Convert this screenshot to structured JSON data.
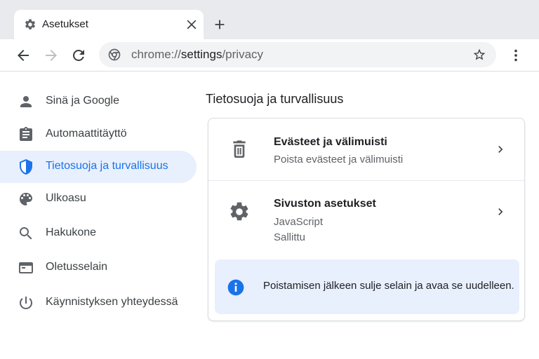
{
  "tab": {
    "title": "Asetukset",
    "icon": "gear-icon"
  },
  "omnibox": {
    "scheme": "chrome://",
    "host": "settings",
    "path": "/privacy"
  },
  "sidebar": {
    "items": [
      {
        "label": "Sinä ja Google",
        "icon": "person-icon",
        "active": false
      },
      {
        "label": "Automaattitäyttö",
        "icon": "clipboard-icon",
        "active": false
      },
      {
        "label": "Tietosuoja ja turvallisuus",
        "icon": "shield-icon",
        "active": true
      },
      {
        "label": "Ulkoasu",
        "icon": "palette-icon",
        "active": false
      },
      {
        "label": "Hakukone",
        "icon": "search-icon",
        "active": false
      },
      {
        "label": "Oletusselain",
        "icon": "browser-window-icon",
        "active": false
      },
      {
        "label": "Käynnistyksen yhteydessä",
        "icon": "power-icon",
        "active": false
      }
    ]
  },
  "main": {
    "title": "Tietosuoja ja turvallisuus",
    "rows": [
      {
        "title": "Evästeet ja välimuisti",
        "subtitle": "Poista evästeet ja välimuisti",
        "icon": "trash-icon"
      },
      {
        "title": "Sivuston asetukset",
        "subtitle": "JavaScript",
        "status": "Sallittu",
        "icon": "gear-icon"
      }
    ],
    "info": {
      "text": "Poistamisen jälkeen sulje selain ja avaa se uudelleen.",
      "icon": "info-icon"
    }
  },
  "colors": {
    "accent": "#1a73e8",
    "active_bg": "#e8f0fe",
    "tabstrip": "#e8eaed"
  }
}
